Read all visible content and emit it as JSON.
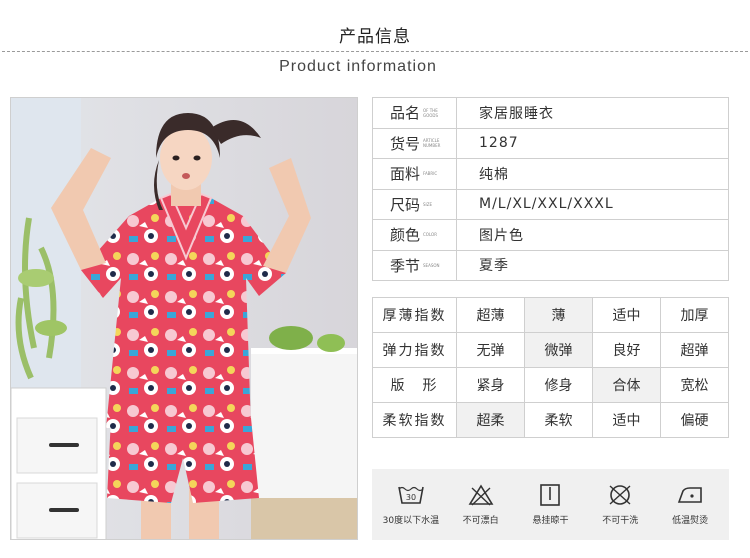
{
  "header": {
    "title_cn": "产品信息",
    "title_en": "Product information"
  },
  "info_rows": [
    {
      "label": "品名",
      "label_en": "OF THE GOODS",
      "value": "家居服睡衣"
    },
    {
      "label": "货号",
      "label_en": "ARTICLE NUMBER",
      "value": "1287"
    },
    {
      "label": "面料",
      "label_en": "FABRIC",
      "value": "纯棉"
    },
    {
      "label": "尺码",
      "label_en": "SIZE",
      "value": "M/L/XL/XXL/XXXL"
    },
    {
      "label": "颜色",
      "label_en": "COLOR",
      "value": "图片色"
    },
    {
      "label": "季节",
      "label_en": "SEASON",
      "value": "夏季"
    }
  ],
  "attributes": [
    {
      "label": "厚薄指数",
      "options": [
        "超薄",
        "薄",
        "适中",
        "加厚"
      ],
      "selected": 1
    },
    {
      "label": "弹力指数",
      "options": [
        "无弹",
        "微弹",
        "良好",
        "超弹"
      ],
      "selected": 1
    },
    {
      "label": "版　形",
      "options": [
        "紧身",
        "修身",
        "合体",
        "宽松"
      ],
      "selected": 2
    },
    {
      "label": "柔软指数",
      "options": [
        "超柔",
        "柔软",
        "适中",
        "偏硬"
      ],
      "selected": 0
    }
  ],
  "care": [
    {
      "icon": "wash-30-icon",
      "label": "30度以下水温",
      "glyph": "30"
    },
    {
      "icon": "no-bleach-icon",
      "label": "不可漂白"
    },
    {
      "icon": "hang-dry-icon",
      "label": "悬挂晾干"
    },
    {
      "icon": "no-dry-clean-icon",
      "label": "不可干洗"
    },
    {
      "icon": "low-iron-icon",
      "label": "低温熨烫"
    }
  ],
  "colors": {
    "border": "#cfcfcf",
    "selected_cell": "#f1f1f1",
    "care_bg": "#f0f0f0",
    "pajama_red": "#e0394f"
  }
}
